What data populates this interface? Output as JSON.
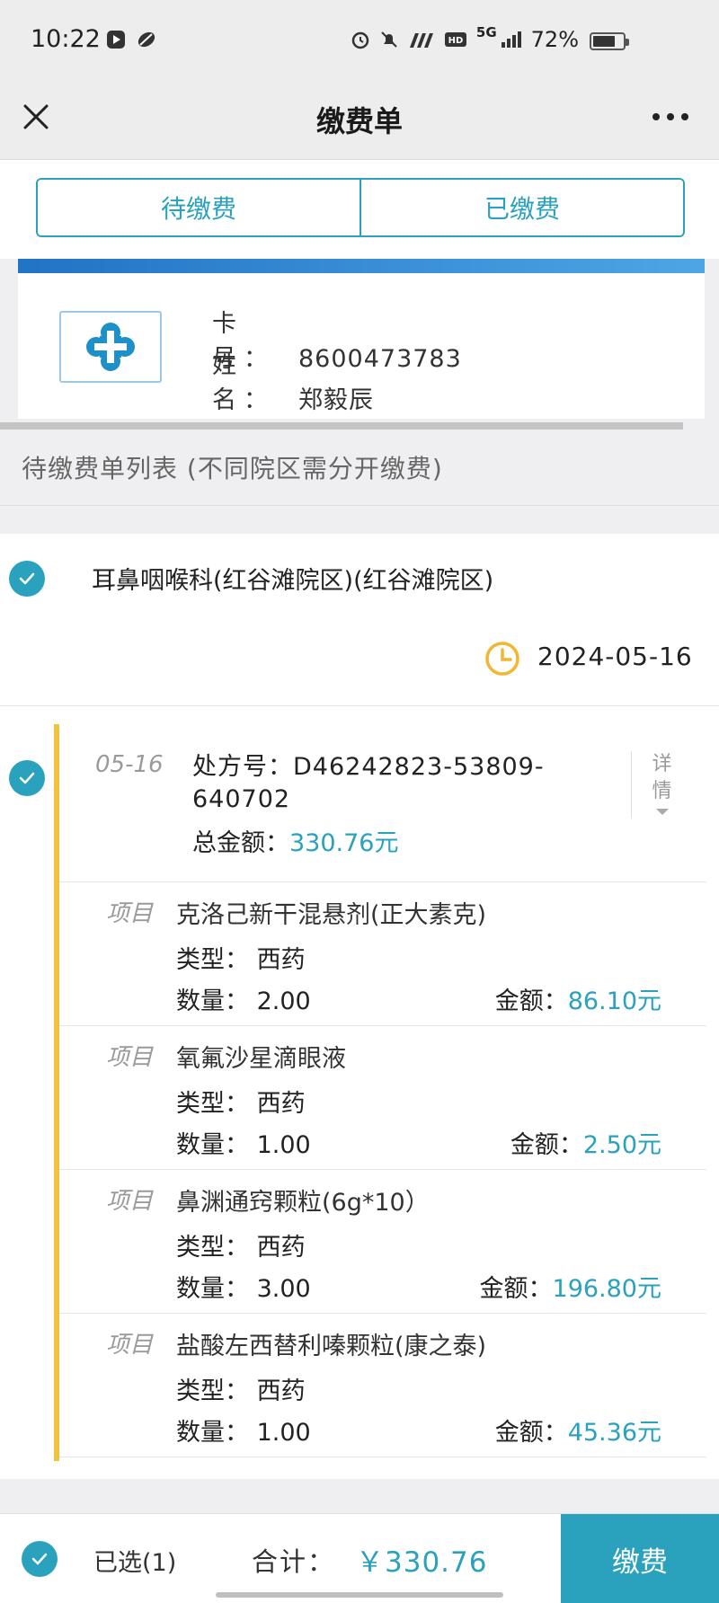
{
  "status_bar": {
    "time": "10:22",
    "network": "5G",
    "battery": "72%"
  },
  "header": {
    "title": "缴费单"
  },
  "tabs": [
    {
      "label": "待缴费"
    },
    {
      "label": "已缴费"
    }
  ],
  "card": {
    "card_label": "卡 号：",
    "card_no": "8600473783",
    "name_label": "姓 名：",
    "name": "郑毅辰"
  },
  "list": {
    "title": "待缴费单列表 (不同院区需分开缴费)"
  },
  "department": {
    "name": "耳鼻咽喉科(红谷滩院区)(红谷滩院区)",
    "date": "2024-05-16"
  },
  "prescription": {
    "date": "05-16",
    "no_label": "处方号：",
    "no": "D46242823-53809-640702",
    "total_label": "总金额：",
    "total": "330.76元",
    "detail_label_1": "详",
    "detail_label_2": "情"
  },
  "items": [
    {
      "tag": "项目",
      "name": "克洛己新干混悬剂(正大素克)",
      "type": "类型：  西药",
      "qty": "数量：  2.00",
      "amt_label": "金额：",
      "amt": "86.10元"
    },
    {
      "tag": "项目",
      "name": "氧氟沙星滴眼液",
      "type": "类型：  西药",
      "qty": "数量：  1.00",
      "amt_label": "金额：",
      "amt": "2.50元"
    },
    {
      "tag": "项目",
      "name": "鼻渊通窍颗粒(6g*10）",
      "type": "类型：  西药",
      "qty": "数量：  3.00",
      "amt_label": "金额：",
      "amt": "196.80元"
    },
    {
      "tag": "项目",
      "name": "盐酸左西替利嗪颗粒(康之泰)",
      "type": "类型：  西药",
      "qty": "数量：  1.00",
      "amt_label": "金额：",
      "amt": "45.36元"
    }
  ],
  "footer": {
    "selected": "已选(1)",
    "sum_label": "合计：",
    "sum_value": "￥330.76",
    "pay_label": "缴费"
  }
}
